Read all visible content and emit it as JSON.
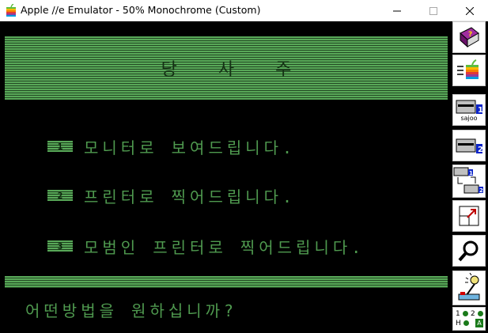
{
  "window": {
    "title": "Apple //e Emulator -  50% Monochrome (Custom)",
    "icon": "apple-rainbow-icon",
    "min_icon": "minimize-icon",
    "max_icon": "maximize-icon",
    "close_icon": "close-icon"
  },
  "screen": {
    "title": "당사주",
    "menu": [
      {
        "key": "1",
        "label": "모니터로 보여드립니다."
      },
      {
        "key": "2",
        "label": "프린터로 찍어드립니다."
      },
      {
        "key": "3",
        "label": "모범인 프린터로 찍어드립니다."
      }
    ],
    "prompt": "어떤방법을 원하십니까?",
    "phosphor_color": "#58a858"
  },
  "toolbar": {
    "help_icon": "help-book-icon",
    "run_icon": "apple-run-icon",
    "drive1": {
      "icon": "disk-drive-1-icon",
      "number": "1",
      "label": "sajoo"
    },
    "drive2": {
      "icon": "disk-drive-2-icon",
      "number": "2"
    },
    "swap_icon": "swap-drives-icon",
    "fullscreen_icon": "fullscreen-icon",
    "debug_icon": "magnifier-icon",
    "settings_icon": "joystick-settings-icon",
    "status": {
      "d1": "1",
      "d2": "2",
      "h": "H",
      "a": "A"
    }
  }
}
